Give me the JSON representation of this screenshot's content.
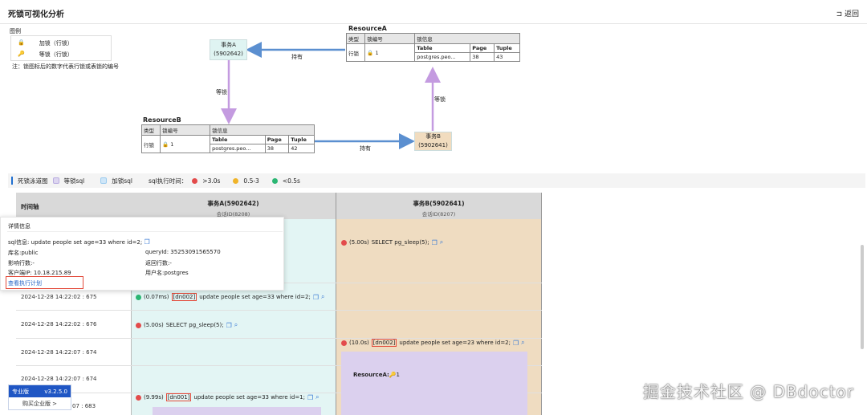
{
  "header": {
    "title": "死锁可视化分析",
    "back_label": "返回"
  },
  "legend": {
    "title": "图例",
    "items": [
      {
        "icon": "lock-icon",
        "label": "加锁（行锁）"
      },
      {
        "icon": "key-icon",
        "label": "等锁（行锁）"
      }
    ],
    "note": "注：锁图标后的数字代表行锁或表锁的编号"
  },
  "graph": {
    "txA": {
      "title": "事务A",
      "id": "(5902642)",
      "color": "#dff4f2"
    },
    "txB": {
      "title": "事务B",
      "id": "(5902641)",
      "color": "#f1dcbf"
    },
    "resourceA": {
      "title": "ResourceA",
      "headers": [
        "类型",
        "锁编号",
        "锁信息"
      ],
      "type": "行锁",
      "lock_no": "1",
      "info_headers": [
        "Table",
        "Page",
        "Tuple"
      ],
      "info_values": [
        "postgres.peo...",
        "38",
        "43"
      ]
    },
    "resourceB": {
      "title": "ResourceB",
      "headers": [
        "类型",
        "锁编号",
        "锁信息"
      ],
      "type": "行锁",
      "lock_no": "1",
      "info_headers": [
        "Table",
        "Page",
        "Tuple"
      ],
      "info_values": [
        "postgres.peo...",
        "38",
        "42"
      ]
    },
    "edges": {
      "hold": "持有",
      "wait": "等锁"
    }
  },
  "flow": {
    "title": "死锁泳道图",
    "wait_sql": "等锁sql",
    "lock_sql": "加锁sql",
    "time_label": "sql执行时间：",
    "levels": [
      {
        "label": ">3.0s",
        "color": "#e34b4b"
      },
      {
        "label": "0.5-3",
        "color": "#f0b429"
      },
      {
        "label": "<0.5s",
        "color": "#2bb673"
      }
    ]
  },
  "lanes": {
    "time_header": "时间轴",
    "a_header": "事务A(5902642)",
    "a_session": "会话ID(8208)",
    "b_header": "事务B(5902641)",
    "b_session": "会话ID(8207)",
    "timestamps": [
      "2024-12-28 14:22:02 : 675",
      "2024-12-28 14:22:02 : 676",
      "2024-12-28 14:22:07 : 674",
      "2024-12-28 14:22:07 : 674",
      "07 : 683"
    ],
    "events": {
      "b1": {
        "time": "(5.00s)",
        "sql": "SELECT pg_sleep(5);"
      },
      "a1": {
        "time": "(0.07ms)",
        "dn": "[dn002]",
        "sql": "update people set age=33 where id=2;"
      },
      "a2": {
        "time": "(5.00s)",
        "sql": "SELECT pg_sleep(5);"
      },
      "b2": {
        "time": "(10.0s)",
        "dn": "[dn002]",
        "sql": "update people set age=23 where id=2;"
      },
      "b_res": "ResourceA:",
      "b_res_no": "1",
      "a3": {
        "time": "(9.99s)",
        "dn": "[dn001]",
        "sql": "update people set age=33 where id=1;"
      }
    }
  },
  "popup": {
    "title": "详情信息",
    "sql_label": "sql信息:",
    "sql": "update people set age=33 where id=2;",
    "db": "库名:public",
    "query_id": "queryId: 35253091565570",
    "rows": "影响行数:-",
    "ret_rows": "返回行数:-",
    "client_ip": "客户端IP: 10.18.215.89",
    "user": "用户名:postgres",
    "plan_link": "查看执行计划"
  },
  "version": {
    "edition": "专业版",
    "version": "v3.2.5.0",
    "upgrade": "购买企业版 >"
  },
  "watermark": "掘金技术社区 @ DBdoctor"
}
